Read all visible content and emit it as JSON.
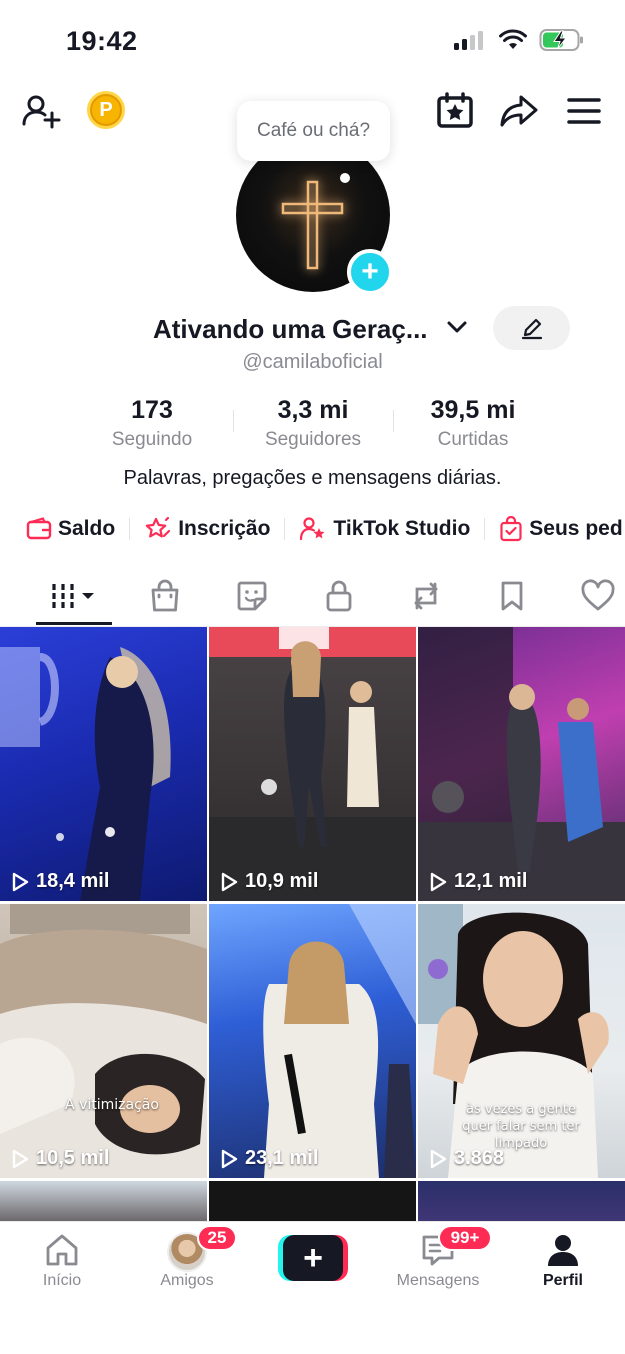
{
  "status_bar": {
    "time": "19:42"
  },
  "profile": {
    "note_bubble": "Café ou chá?",
    "display_name": "Ativando uma Geraç...",
    "username": "@camilaboficial",
    "bio": "Palavras, pregações e mensagens diárias."
  },
  "stats": [
    {
      "value": "173",
      "label": "Seguindo"
    },
    {
      "value": "3,3 mi",
      "label": "Seguidores"
    },
    {
      "value": "39,5 mi",
      "label": "Curtidas"
    }
  ],
  "shortcuts": [
    {
      "label": "Saldo",
      "icon": "wallet-icon"
    },
    {
      "label": "Inscrição",
      "icon": "subscription-star-icon"
    },
    {
      "label": "TikTok Studio",
      "icon": "creator-studio-icon"
    },
    {
      "label": "Seus ped",
      "icon": "shopping-bag-icon"
    }
  ],
  "tabs": [
    {
      "name": "videos",
      "icon": "grid-icon",
      "active": true
    },
    {
      "name": "shop",
      "icon": "shopping-bag-icon"
    },
    {
      "name": "stickers",
      "icon": "sticker-icon"
    },
    {
      "name": "private",
      "icon": "lock-icon"
    },
    {
      "name": "reposts",
      "icon": "repost-icon"
    },
    {
      "name": "favorites",
      "icon": "bookmark-icon"
    },
    {
      "name": "liked",
      "icon": "heart-icon"
    }
  ],
  "videos": [
    {
      "views": "18,4 mil"
    },
    {
      "views": "10,9 mil"
    },
    {
      "views": "12,1 mil"
    },
    {
      "views": "10,5 mil",
      "caption": "A vitimização"
    },
    {
      "views": "23,1 mil"
    },
    {
      "views": "3.868",
      "caption": "às vezes a gente quer falar sem ter limpado"
    }
  ],
  "bottom_nav": {
    "home": "Início",
    "friends": "Amigos",
    "friends_badge": "25",
    "messages": "Mensagens",
    "messages_badge": "99+",
    "profile": "Perfil"
  },
  "colors": {
    "accent": "#fe2c55",
    "cyan": "#25f4ee",
    "text": "#161823",
    "muted": "#8a8b91"
  }
}
